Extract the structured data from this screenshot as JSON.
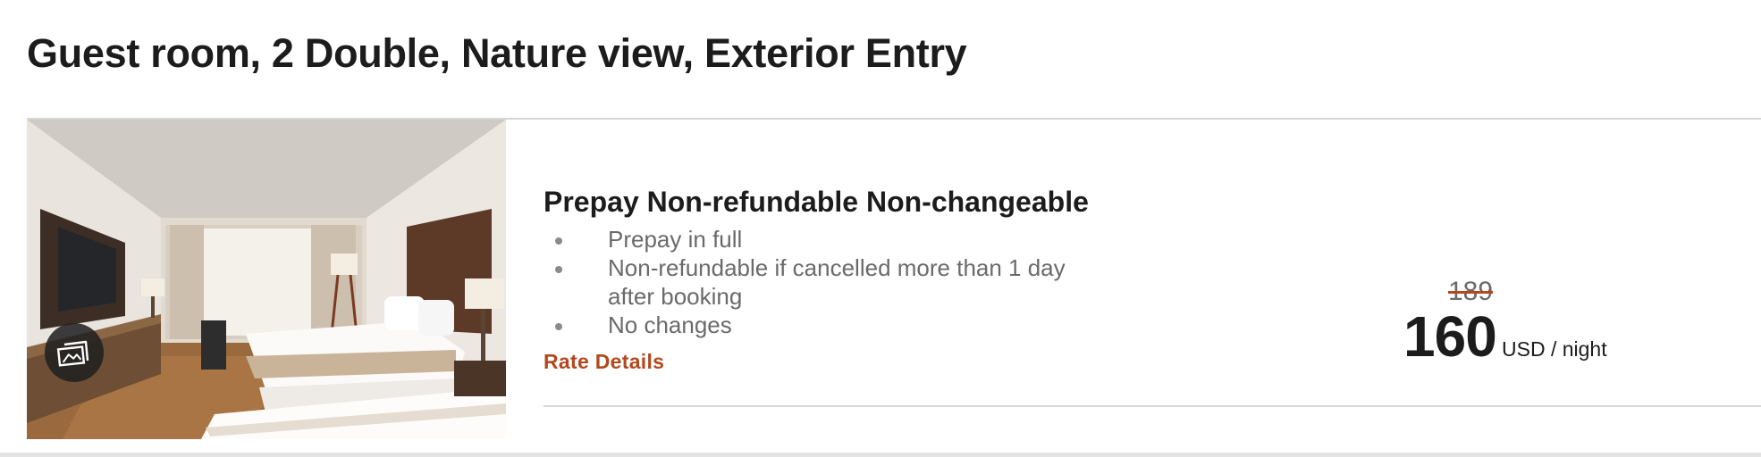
{
  "room": {
    "title": "Guest room, 2 Double, Nature view, Exterior Entry",
    "photo_icon": "gallery-icon"
  },
  "rate": {
    "name": "Prepay Non-refundable Non-changeable",
    "features": [
      "Prepay in full",
      "Non-refundable if cancelled more than 1 day after booking",
      "No changes"
    ],
    "details_link": "Rate Details",
    "original_price": "189",
    "price": "160",
    "price_unit": "USD / night"
  },
  "colors": {
    "accent": "#b3481f",
    "text_primary": "#1c1c1c",
    "text_secondary": "#6a6a6a",
    "divider": "#d6d6d6"
  }
}
